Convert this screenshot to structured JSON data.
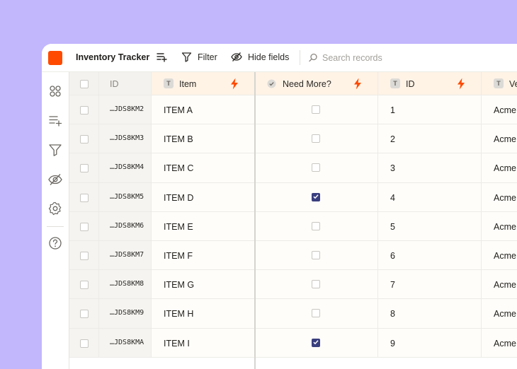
{
  "toolbar": {
    "app_title": "Inventory Tracker",
    "filter_label": "Filter",
    "hide_fields_label": "Hide fields",
    "search_placeholder": "Search records"
  },
  "sidebar": {
    "icons": [
      "apps-icon",
      "add-field-icon",
      "filter-icon",
      "hide-icon",
      "settings-icon",
      "help-icon"
    ]
  },
  "table": {
    "columns": [
      {
        "label": "ID",
        "type": "id"
      },
      {
        "label": "Item",
        "type": "T"
      },
      {
        "label": "Need More?",
        "type": "checkbox"
      },
      {
        "label": "ID",
        "type": "T"
      },
      {
        "label": "Ve",
        "type": "T"
      }
    ],
    "rows": [
      {
        "rid": "…JDS8KM2",
        "item": "ITEM A",
        "need": false,
        "id": "1",
        "vendor": "Acme"
      },
      {
        "rid": "…JDS8KM3",
        "item": "ITEM B",
        "need": false,
        "id": "2",
        "vendor": "Acme"
      },
      {
        "rid": "…JDS8KM4",
        "item": "ITEM C",
        "need": false,
        "id": "3",
        "vendor": "Acme"
      },
      {
        "rid": "…JDS8KM5",
        "item": "ITEM D",
        "need": true,
        "id": "4",
        "vendor": "Acme"
      },
      {
        "rid": "…JDS8KM6",
        "item": "ITEM E",
        "need": false,
        "id": "5",
        "vendor": "Acme"
      },
      {
        "rid": "…JDS8KM7",
        "item": "ITEM F",
        "need": false,
        "id": "6",
        "vendor": "Acme"
      },
      {
        "rid": "…JDS8KM8",
        "item": "ITEM G",
        "need": false,
        "id": "7",
        "vendor": "Acme"
      },
      {
        "rid": "…JDS8KM9",
        "item": "ITEM H",
        "need": false,
        "id": "8",
        "vendor": "Acme"
      },
      {
        "rid": "…JDS8KMA",
        "item": "ITEM I",
        "need": true,
        "id": "9",
        "vendor": "Acme"
      }
    ]
  },
  "colors": {
    "accent": "#ff4a00",
    "checkbox_checked": "#3a3f7e",
    "header_bg": "#fff3e6",
    "background": "#c2b6fd"
  }
}
